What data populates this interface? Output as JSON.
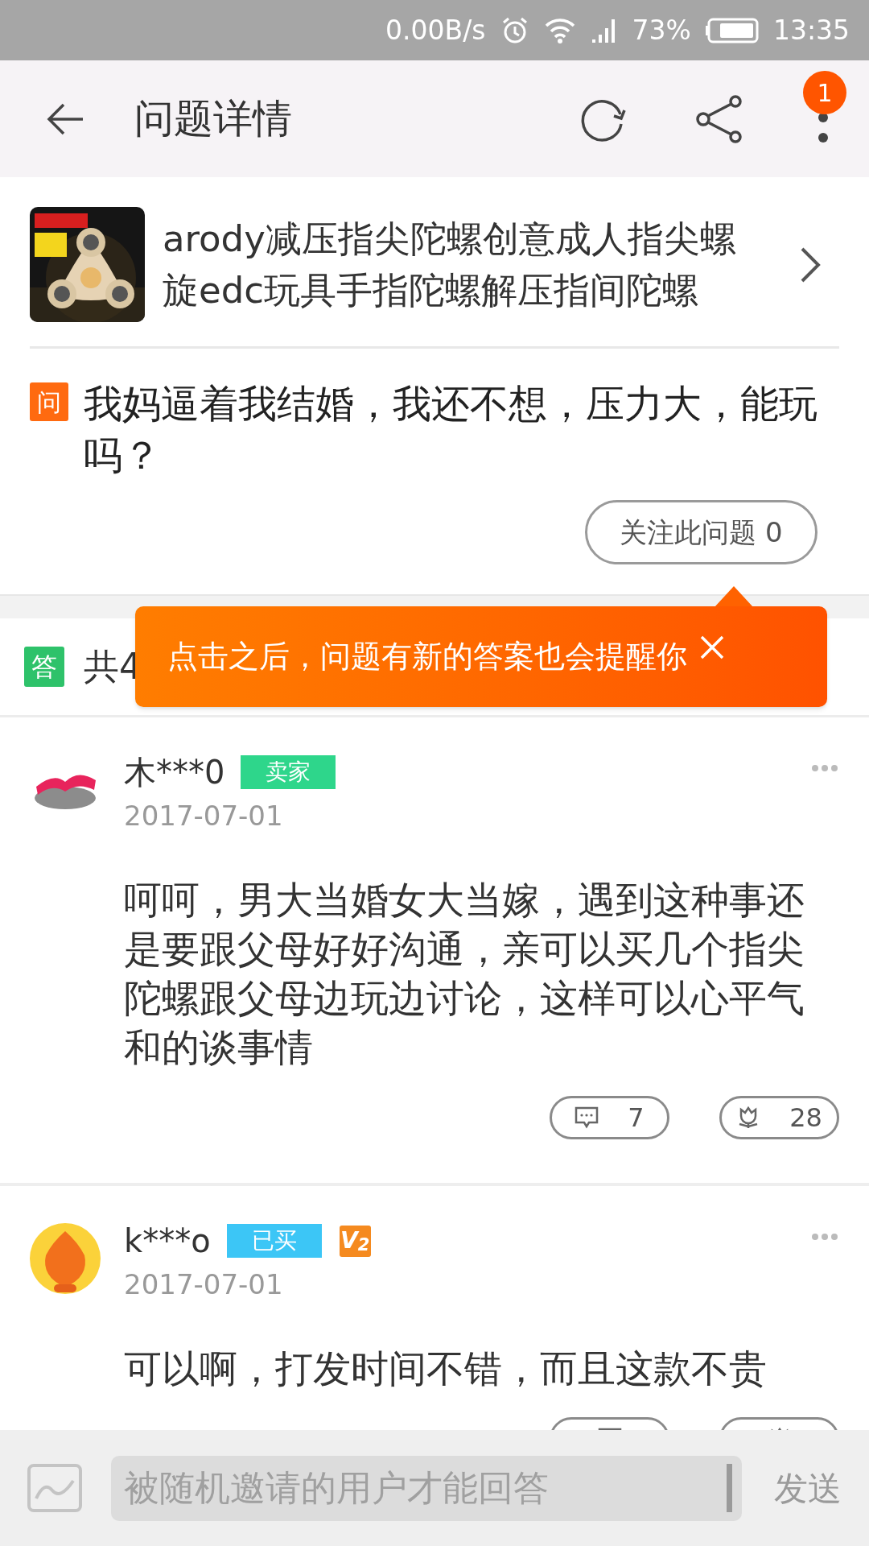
{
  "status_bar": {
    "network_speed": "0.00B/s",
    "battery_percent": "73%",
    "time": "13:35"
  },
  "header": {
    "title": "问题详情",
    "notification_count": "1"
  },
  "product": {
    "title": "arody减压指尖陀螺创意成人指尖螺旋edc玩具手指陀螺解压指间陀螺"
  },
  "question": {
    "marker": "问",
    "text": "我妈逼着我结婚，我还不想，压力大，能玩吗？",
    "follow_button": "关注此问题 0"
  },
  "tooltip": {
    "text": "点击之后，问题有新的答案也会提醒你"
  },
  "answers_heading": {
    "marker": "答",
    "count_text": "共4"
  },
  "answers": [
    {
      "user": "木***0",
      "tag": {
        "label": "卖家",
        "color": "#2ed68b"
      },
      "date": "2017-07-01",
      "text": "呵呵，男大当婚女大当嫁，遇到这种事还是要跟父母好好沟通，亲可以买几个指尖陀螺跟父母边玩边讨论，这样可以心平气和的谈事情",
      "comments": "7",
      "likes": "28"
    },
    {
      "user": "k***o",
      "tag": {
        "label": "已买",
        "color": "#3cc6f6"
      },
      "level_badge": "V$_{2}$",
      "date": "2017-07-01",
      "text": "可以啊，打发时间不错，而且这款不贵"
    }
  ],
  "answer_box": {
    "placeholder": "被随机邀请的用户才能回答",
    "send": "发送"
  }
}
